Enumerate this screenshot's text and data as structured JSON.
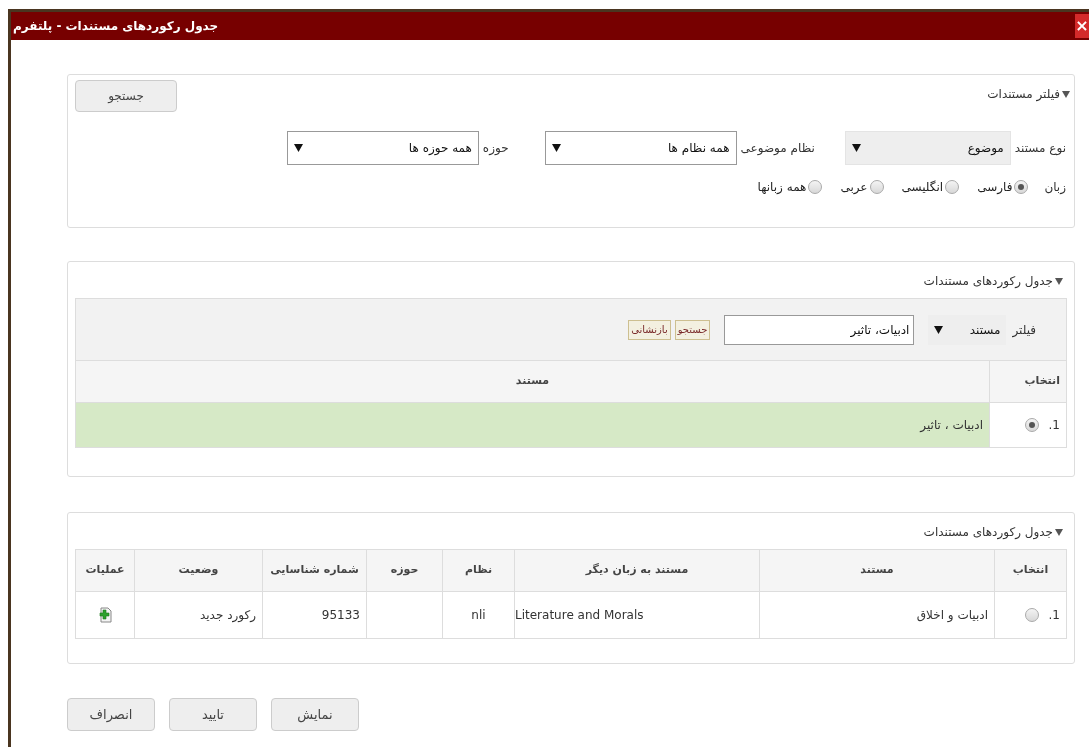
{
  "window": {
    "title": "جدول رکوردهای مستندات - پلتفرم",
    "close": "×"
  },
  "filter_panel": {
    "title": "فیلتر مستندات",
    "expanded": true,
    "search_button": "جستجو",
    "fields": [
      {
        "label": "نوع مستند",
        "value": "موضوع",
        "kind": "gray"
      },
      {
        "label": "نظام موضوعی",
        "value": "همه نظام ها",
        "kind": "white"
      },
      {
        "label": "حوزه",
        "value": "همه حوزه ها",
        "kind": "white"
      }
    ],
    "language": {
      "label": "زبان",
      "options": [
        {
          "label": "فارسی",
          "selected": true
        },
        {
          "label": "انگلیسی",
          "selected": false
        },
        {
          "label": "عربی",
          "selected": false
        },
        {
          "label": "همه زبانها",
          "selected": false
        }
      ]
    }
  },
  "search_panel": {
    "title": "جدول رکوردهای مستندات",
    "expanded": true,
    "filter_label": "فیلتر",
    "filter_select": "مستند",
    "query": "ادبیات، تاثیر",
    "search_button": "جستجو",
    "reset_button": "بازنشانی",
    "columns": [
      "انتخاب",
      "مستند"
    ],
    "rows": [
      {
        "index": "1.",
        "selected": true,
        "document": "ادبیات ، تاثیر"
      }
    ]
  },
  "records_panel": {
    "title": "جدول رکوردهای مستندات",
    "expanded": true,
    "columns": [
      "انتخاب",
      "مستند",
      "مستند به زبان دیگر",
      "نظام",
      "حوزه",
      "شماره شناسایی",
      "وضعیت",
      "عملیات"
    ],
    "rows": [
      {
        "index": "1.",
        "selected": false,
        "document": "ادبیات و اخلاق",
        "other_language": "Literature and Morals",
        "system": "nli",
        "domain_code": "",
        "id": "95133",
        "status": "رکورد جدید"
      }
    ]
  },
  "buttons": [
    "نمایش",
    "تایید",
    "انصراف"
  ]
}
